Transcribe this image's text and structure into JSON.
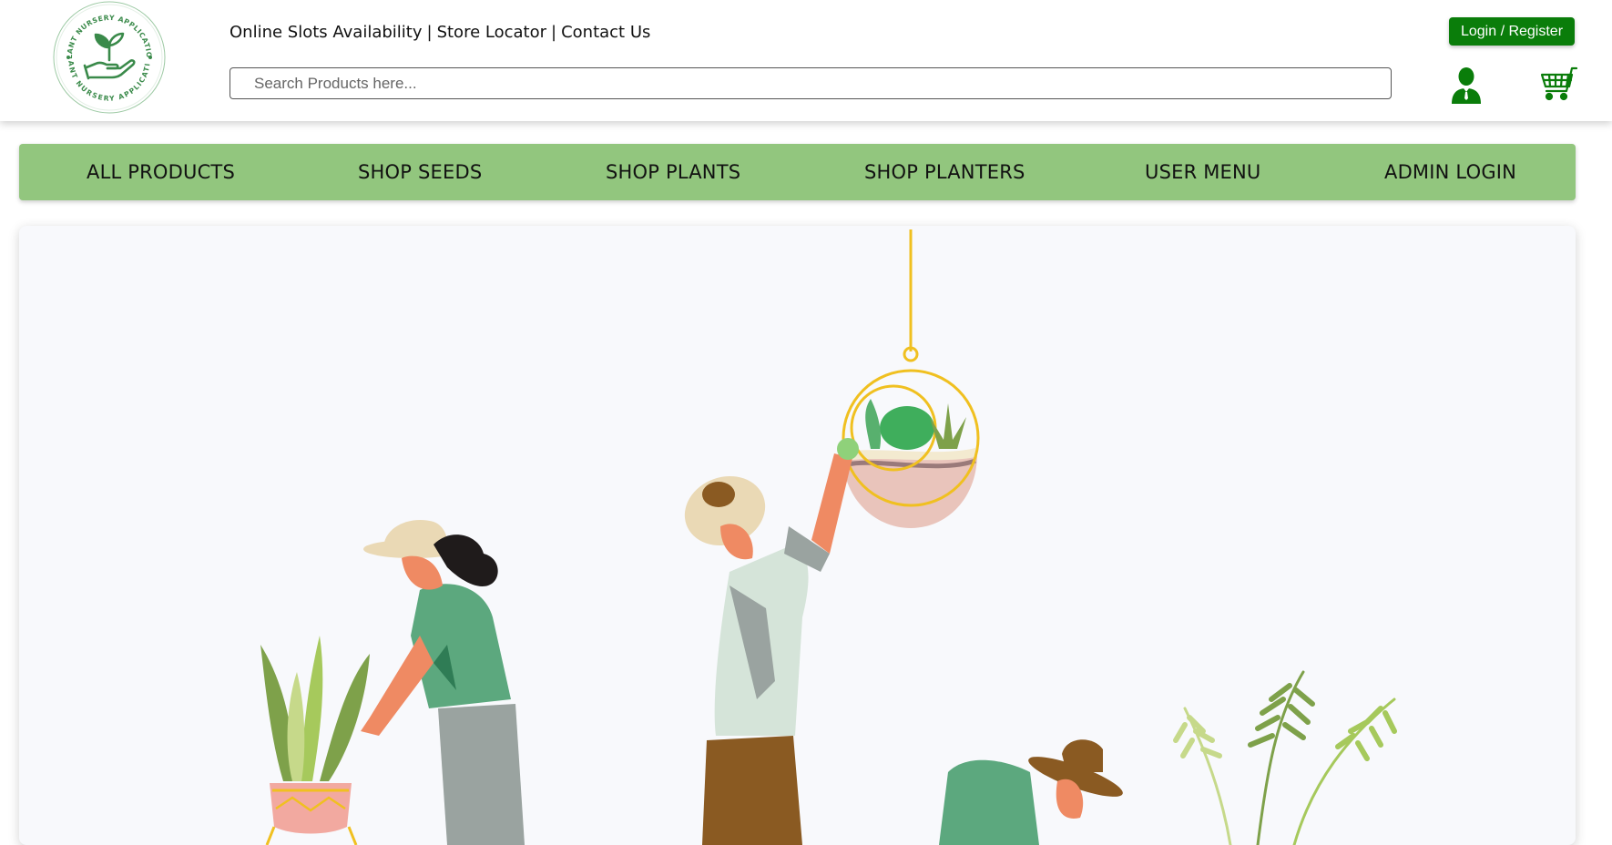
{
  "header": {
    "logo": {
      "text_top": "PLANT NURSERY APPLICATION",
      "text_bottom": "PLANT NURSERY APPLICATION",
      "icon": "seedling-hand-icon"
    },
    "links": [
      {
        "label": "Online Slots Availability"
      },
      {
        "label": "Store Locator"
      },
      {
        "label": "Contact Us"
      }
    ],
    "link_separator": "|",
    "search": {
      "placeholder": "Search Products here...",
      "value": ""
    },
    "login_label": "Login / Register",
    "icons": {
      "user": "user-icon",
      "cart": "cart-icon"
    }
  },
  "nav": {
    "items": [
      {
        "label": "ALL PRODUCTS"
      },
      {
        "label": "SHOP SEEDS"
      },
      {
        "label": "SHOP PLANTS"
      },
      {
        "label": "SHOP PLANTERS"
      },
      {
        "label": "USER MENU"
      },
      {
        "label": "ADMIN LOGIN"
      }
    ]
  },
  "hero": {
    "illustration": "gardeners-with-plants-illustration"
  },
  "colors": {
    "brand_green": "#0a7d0a",
    "nav_green": "#92c67e",
    "logo_green": "#3a8a4a"
  }
}
